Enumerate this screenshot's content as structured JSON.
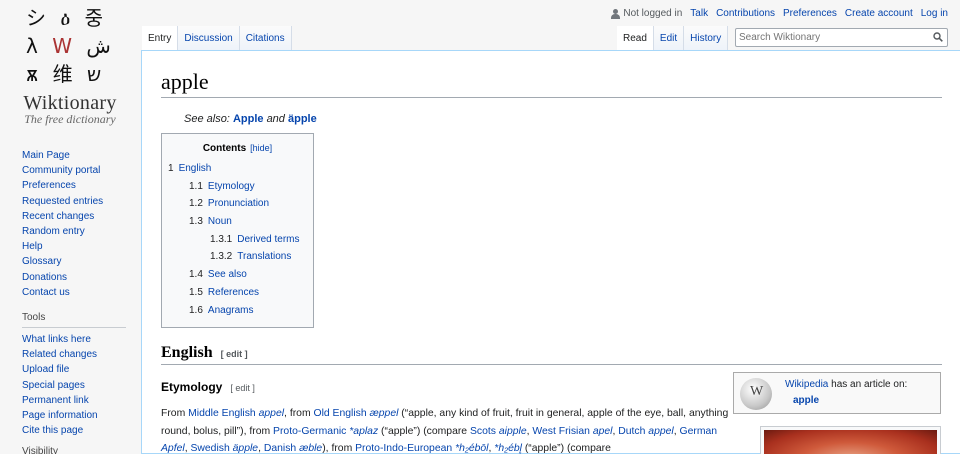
{
  "logo": {
    "glyph_rows": [
      [
        "シ",
        "ዕ",
        "중"
      ],
      [
        "λ",
        "W",
        "ش"
      ],
      [
        "ѫ",
        "维",
        "ש"
      ]
    ],
    "title": "Wiktionary",
    "tagline": "The free dictionary"
  },
  "nav": [
    "Main Page",
    "Community portal",
    "Preferences",
    "Requested entries",
    "Recent changes",
    "Random entry",
    "Help",
    "Glossary",
    "Donations",
    "Contact us"
  ],
  "tools": {
    "heading": "Tools",
    "items": [
      "What links here",
      "Related changes",
      "Upload file",
      "Special pages",
      "Permanent link",
      "Page information",
      "Cite this page"
    ],
    "next_heading": "Visibility"
  },
  "personal": {
    "status": "Not logged in",
    "links": [
      "Talk",
      "Contributions",
      "Preferences",
      "Create account",
      "Log in"
    ]
  },
  "tabs": {
    "left": [
      "Entry",
      "Discussion",
      "Citations"
    ],
    "right": [
      "Read",
      "Edit",
      "History"
    ]
  },
  "search": {
    "placeholder": "Search Wiktionary"
  },
  "page": {
    "title": "apple",
    "see_also_prefix": "See also:",
    "see_also_1": "Apple",
    "see_also_and": "and",
    "see_also_2": "äpple"
  },
  "toc": {
    "title": "Contents",
    "hide": "[hide]",
    "items": [
      {
        "num": "1",
        "label": "English",
        "level": 1
      },
      {
        "num": "1.1",
        "label": "Etymology",
        "level": 2
      },
      {
        "num": "1.2",
        "label": "Pronunciation",
        "level": 2
      },
      {
        "num": "1.3",
        "label": "Noun",
        "level": 2
      },
      {
        "num": "1.3.1",
        "label": "Derived terms",
        "level": 3
      },
      {
        "num": "1.3.2",
        "label": "Translations",
        "level": 3
      },
      {
        "num": "1.4",
        "label": "See also",
        "level": 2
      },
      {
        "num": "1.5",
        "label": "References",
        "level": 2
      },
      {
        "num": "1.6",
        "label": "Anagrams",
        "level": 2
      }
    ]
  },
  "sections": {
    "english": "English",
    "edit": "[ edit ]",
    "etymology": "Etymology"
  },
  "wikipedia": {
    "globe": "W",
    "link": "Wikipedia",
    "text": "has an article on:",
    "term": "apple"
  },
  "etymology_text": {
    "t1": "From ",
    "l1": "Middle English",
    "t2": " ",
    "l2": "appel",
    "t3": ", from ",
    "l3": "Old English",
    "t4": " ",
    "l4": "æppel",
    "t5": " (“apple, any kind of fruit, fruit in general, apple of the eye, ball, anything round, bolus, pill”), from ",
    "l5": "Proto-Germanic",
    "t6": " ",
    "l6": "*aplaz",
    "t7": " (“apple”) (compare ",
    "l7": "Scots",
    "t8": " ",
    "l8": "aipple",
    "t9": ", ",
    "l9": "West Frisian",
    "t10": " ",
    "l10": "apel",
    "t11": ", ",
    "l11": "Dutch",
    "t12": " ",
    "l12": "appel",
    "t13": ", ",
    "l13": "German",
    "t14": " ",
    "l14": "Apfel",
    "t15": ", ",
    "l15": "Swedish",
    "t16": " ",
    "l16": "äpple",
    "t17": ", ",
    "l17": "Danish",
    "t18": " ",
    "l18": "æble",
    "t19": "), from ",
    "l19": "Proto-Indo-European",
    "t20": " ",
    "l20": "*h₂ébōl",
    "t21": ", ",
    "l21": "*h₂ébl̥",
    "t22": " (“apple”) (compare"
  }
}
